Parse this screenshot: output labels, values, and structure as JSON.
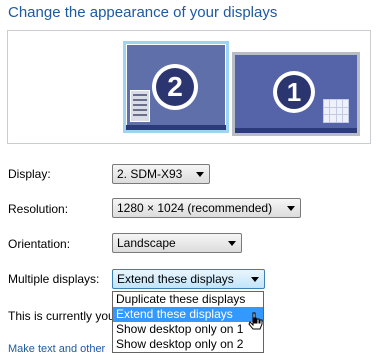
{
  "page": {
    "title": "Change the appearance of your displays"
  },
  "preview": {
    "monitors": [
      {
        "number": "2",
        "selected": true
      },
      {
        "number": "1",
        "selected": false
      }
    ],
    "colors": {
      "selected_border": "#9fd3f2",
      "screen": "#5564a8",
      "badge": "#2b356f"
    }
  },
  "display": {
    "label": "Display:",
    "value": "2. SDM-X93"
  },
  "resolution": {
    "label": "Resolution:",
    "value": "1280 × 1024 (recommended)"
  },
  "orientation": {
    "label": "Orientation:",
    "value": "Landscape"
  },
  "multiple_displays": {
    "label": "Multiple displays:",
    "value": "Extend these displays",
    "options": [
      "Duplicate these displays",
      "Extend these displays",
      "Show desktop only on 1",
      "Show desktop only on 2"
    ],
    "highlighted_option": "Extend these displays"
  },
  "status_text": "This is currently you",
  "link_text": "Make text and other"
}
